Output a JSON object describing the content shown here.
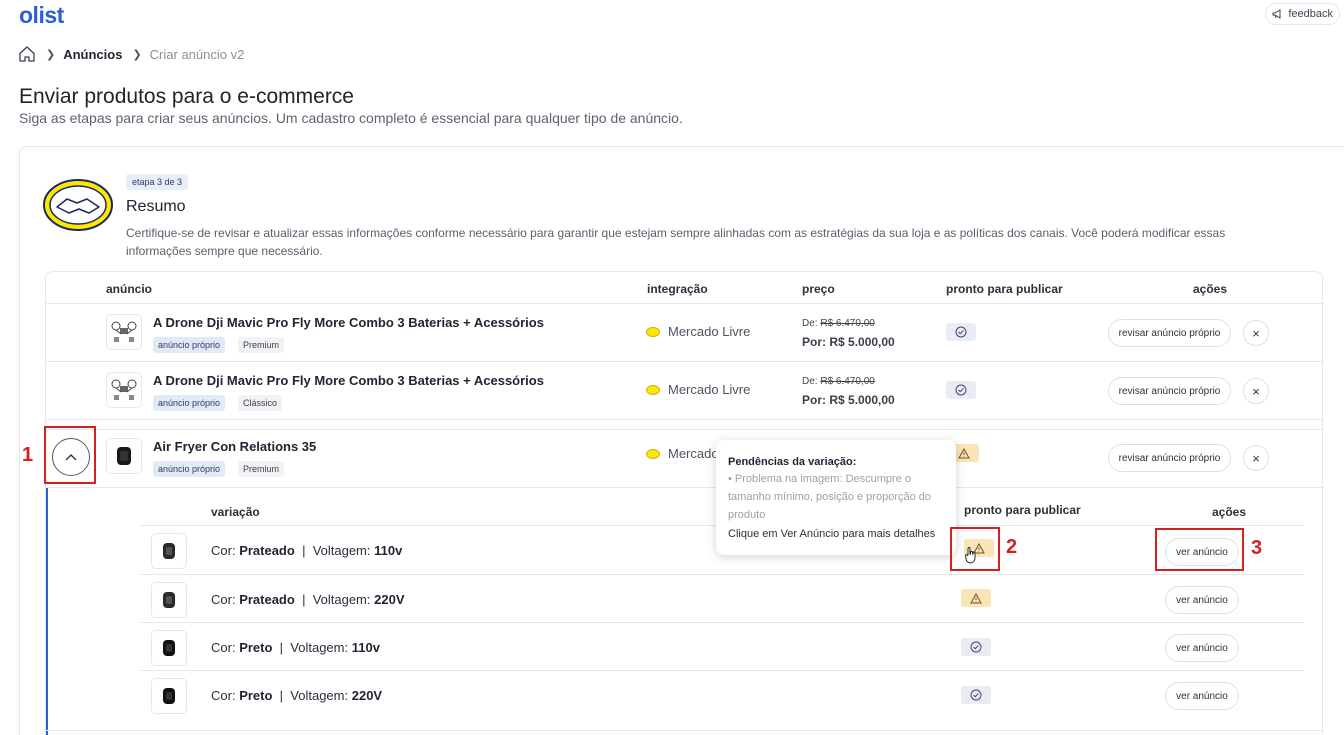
{
  "header": {
    "logo": "olist",
    "feedback_label": "feedback"
  },
  "breadcrumb": {
    "current": "Anúncios",
    "last": "Criar anúncio v2"
  },
  "page": {
    "title": "Enviar produtos para o e-commerce",
    "subtitle": "Siga as etapas para criar seus anúncios. Um cadastro completo é essencial para qualquer tipo de anúncio."
  },
  "step": {
    "badge": "etapa 3 de 3",
    "title": "Resumo",
    "description": "Certifique-se de revisar e atualizar essas informações conforme necessário para garantir que estejam sempre alinhadas com as estratégias da sua loja e as políticas dos canais. Você poderá modificar essas informações sempre que necessário."
  },
  "table": {
    "headers": {
      "anuncio": "anúncio",
      "integracao": "integração",
      "preco": "preço",
      "pronto": "pronto para publicar",
      "acoes": "ações"
    },
    "rows": [
      {
        "name": "A Drone Dji Mavic Pro Fly More Combo 3 Baterias + Acessórios",
        "tag1": "anúncio próprio",
        "tag2": "Premium",
        "integration": "Mercado Livre",
        "price_de_label": "De:",
        "price_de": "R$ 6.470,00",
        "price_por_label": "Por:",
        "price_por": "R$ 5.000,00",
        "status": "ok",
        "action": "revisar anúncio próprio"
      },
      {
        "name": "A Drone Dji Mavic Pro Fly More Combo 3 Baterias + Acessórios",
        "tag1": "anúncio próprio",
        "tag2": "Clássico",
        "integration": "Mercado Livre",
        "price_de_label": "De:",
        "price_de": "R$ 6.470,00",
        "price_por_label": "Por:",
        "price_por": "R$ 5.000,00",
        "status": "ok",
        "action": "revisar anúncio próprio"
      },
      {
        "name": "Air Fryer Con Relations 35",
        "tag1": "anúncio próprio",
        "tag2": "Premium",
        "integration": "Mercado Livre",
        "status": "warn",
        "action": "revisar anúncio próprio"
      }
    ],
    "remove_symbol": "×"
  },
  "variations": {
    "headers": {
      "variacao": "variação",
      "pronto": "pronto para publicar",
      "acoes": "ações"
    },
    "color_label": "Cor:",
    "voltage_label": "Voltagem:",
    "separator": "|",
    "action": "ver anúncio",
    "rows": [
      {
        "color": "Prateado",
        "voltage": "110v",
        "status": "warn"
      },
      {
        "color": "Prateado",
        "voltage": "220V",
        "status": "warn"
      },
      {
        "color": "Preto",
        "voltage": "110v",
        "status": "ok"
      },
      {
        "color": "Preto",
        "voltage": "220V",
        "status": "ok"
      }
    ]
  },
  "tooltip": {
    "title": "Pendências da variação:",
    "body": "• Problema na imagem: Descumpre o tamanho mínimo, posição e proporção do produto",
    "footer": "Clique em Ver Anúncio para mais detalhes"
  },
  "annotations": [
    "1",
    "2",
    "3"
  ],
  "colors": {
    "brand": "#2d5fd3",
    "annotation": "#d62020",
    "warn_bg": "#fbe5b8",
    "ok_bg": "#e7ecf5"
  }
}
